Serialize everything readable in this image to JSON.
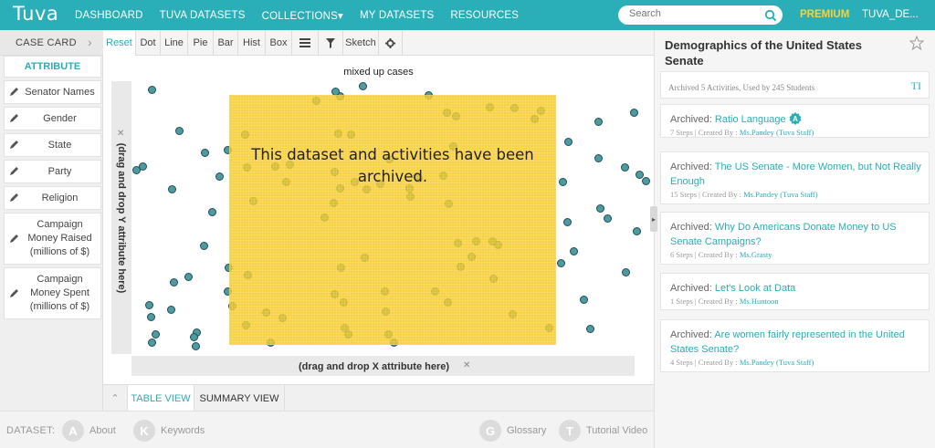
{
  "brand": {
    "logo_text": "Tuva",
    "accent": "#2aaeb7",
    "premium_color": "#f7d23b",
    "archived_overlay_color": "#f5c81e"
  },
  "nav": {
    "links": [
      "DASHBOARD",
      "TUVA DATASETS",
      "COLLECTIONS▾",
      "MY DATASETS",
      "RESOURCES"
    ],
    "search_placeholder": "Search",
    "premium": "PREMIUM",
    "user": "TUVA_DE..."
  },
  "case_card": {
    "title": "CASE CARD",
    "attribute_header": "ATTRIBUTE",
    "attributes": [
      "Senator Names",
      "Gender",
      "State",
      "Party",
      "Religion",
      "Campaign Money Raised (millions of $)",
      "Campaign Money Spent (millions of $)"
    ]
  },
  "toolbar": {
    "buttons": [
      "Reset",
      "Dot",
      "Line",
      "Pie",
      "Bar",
      "Hist",
      "Box",
      "☰",
      "▼",
      "Sketch",
      "⚙"
    ],
    "active": "Reset"
  },
  "graph": {
    "title": "mixed up cases",
    "y_placeholder": "(drag and drop Y attribute here)",
    "x_placeholder": "(drag and drop X attribute here)",
    "archived_message": "This dataset and activities have been archived."
  },
  "bottom_tabs": {
    "items": [
      "TABLE VIEW",
      "SUMMARY VIEW"
    ],
    "active": "TABLE VIEW"
  },
  "footer": {
    "dataset_label": "DATASET:",
    "buttons": [
      {
        "letter": "A",
        "label": "About"
      },
      {
        "letter": "K",
        "label": "Keywords"
      },
      {
        "letter": "G",
        "label": "Glossary"
      },
      {
        "letter": "T",
        "label": "Tutorial Video"
      }
    ]
  },
  "right_panel": {
    "title": "Demographics of the United States Senate",
    "stats": "Archived 5 Activities, Used by 245 Students",
    "stats_icon": "TI",
    "activities": [
      {
        "prefix": "Archived: ",
        "name": "Ratio Language",
        "steps": "7 Steps",
        "created_label": "Created By : ",
        "author": "Ms.Pandey (Tuva Staff)",
        "badge": "A"
      },
      {
        "prefix": "Archived: ",
        "name": "The US Senate - More Women, but Not Really Enough",
        "steps": "15 Steps",
        "created_label": "Created By : ",
        "author": "Ms.Pandey (Tuva Staff)"
      },
      {
        "prefix": "Archived: ",
        "name": "Why Do Americans Donate Money to US Senate Campaigns?",
        "steps": "6 Steps",
        "created_label": "Created By : ",
        "author": "Ms.Grasty"
      },
      {
        "prefix": "Archived: ",
        "name": "Let's Look at Data",
        "steps": "1 Steps",
        "created_label": "Created By : ",
        "author": "Ms.Huntoon"
      },
      {
        "prefix": "Archived: ",
        "name": "Are women fairly represented in the United States Senate?",
        "steps": "4 Steps",
        "created_label": "Created By : ",
        "author": "Ms.Pandey (Tuva Staff)"
      }
    ],
    "meta_separator": " | "
  }
}
